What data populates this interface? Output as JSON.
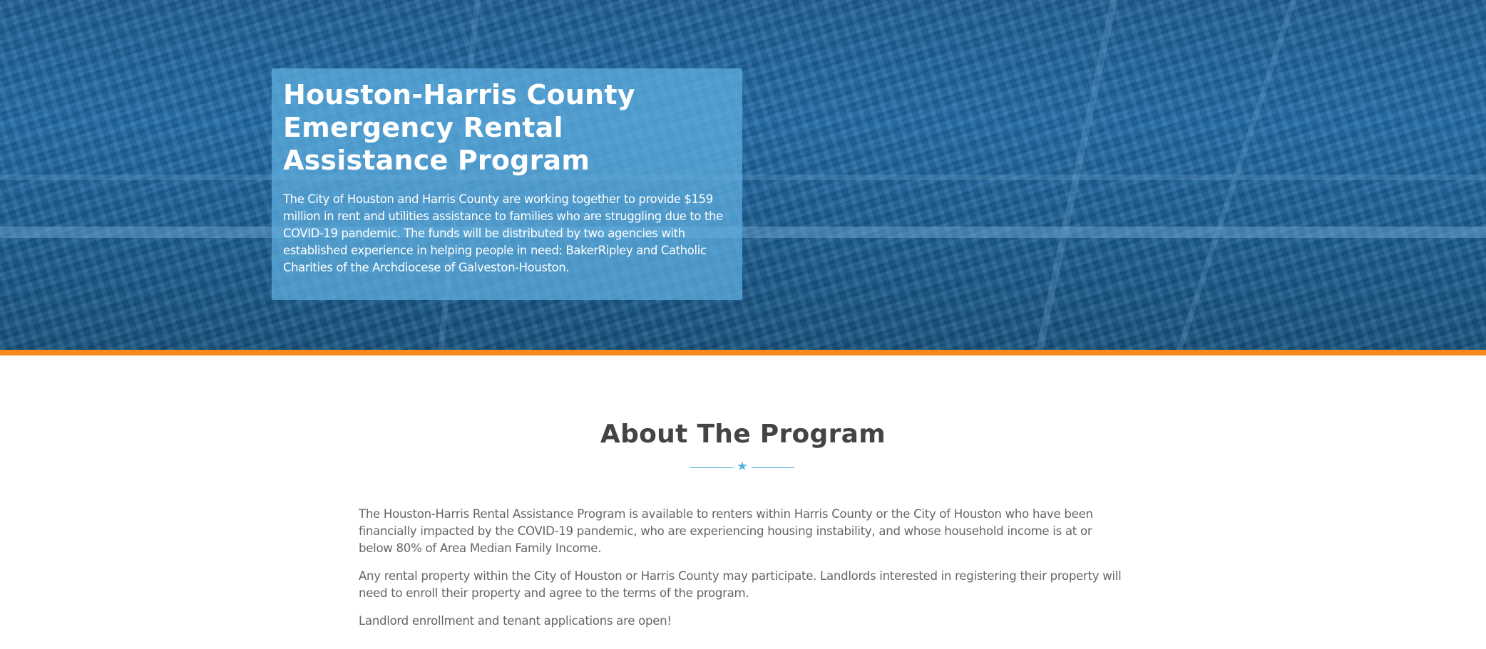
{
  "hero": {
    "title": "Houston-Harris County Emergency Rental Assistance Program",
    "description": "The City of Houston and Harris County are working together to provide $159 million in rent and utilities assistance to families who are struggling due to the COVID-19 pandemic. The funds will be distributed by two agencies with established experience in helping people in need: BakerRipley and Catholic Charities of the Archdiocese of Galveston-Houston.",
    "accent_bar_color": "#f5891f",
    "card_color": "#60b0e0"
  },
  "about": {
    "title": "About The Program",
    "divider_icon": "star-icon",
    "paragraphs": [
      "The Houston-Harris Rental Assistance Program is available to renters within Harris County or the City of Houston who have been financially impacted by the COVID-19 pandemic, who are experiencing housing instability, and whose household income is at or below 80% of Area Median Family Income.",
      "Any rental property within the City of Houston or Harris County may participate. Landlords interested in registering their property will need to enroll their property and agree to the terms of the program.",
      "Landlord enrollment and tenant applications are open!"
    ]
  }
}
